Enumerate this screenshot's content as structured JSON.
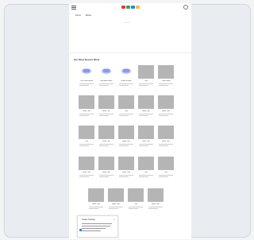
{
  "header": {
    "logo_colors": [
      "#e53935",
      "#43a047",
      "#1e88e5",
      "#fbc02d"
    ],
    "links": [
      "Home",
      "Books"
    ],
    "hero_text": "Search"
  },
  "section": {
    "heading": "Our Most Recent Work"
  },
  "rows": [
    {
      "items": [
        {
          "title": "Our Planet Book",
          "illus": true
        },
        {
          "title": "Big Ideas Book",
          "illus": true
        },
        {
          "title": "Science Book",
          "illus": true
        },
        {
          "title": "Title",
          "illus": false
        },
        {
          "title": "Cover Book",
          "illus": false
        }
      ]
    },
    {
      "items": [
        {
          "title": "Book Title",
          "illus": false
        },
        {
          "title": "Book Title",
          "illus": false
        },
        {
          "title": "Title",
          "illus": false
        },
        {
          "title": "Book Title",
          "illus": false
        },
        {
          "title": "Book Title",
          "illus": false
        }
      ]
    },
    {
      "items": [
        {
          "title": "Title",
          "illus": false
        },
        {
          "title": "Book Title",
          "illus": false
        },
        {
          "title": "Book Title",
          "illus": false
        },
        {
          "title": "Book Title",
          "illus": false
        },
        {
          "title": "Book Title",
          "illus": false
        }
      ]
    },
    {
      "items": [
        {
          "title": "Book Title",
          "illus": false
        },
        {
          "title": "Book Title",
          "illus": false
        },
        {
          "title": "Book Title",
          "illus": false
        },
        {
          "title": "Title",
          "illus": false
        },
        {
          "title": "Title",
          "illus": false
        }
      ]
    },
    {
      "items": [
        {
          "title": "Book Title",
          "illus": false
        },
        {
          "title": "Book Title",
          "illus": false
        },
        {
          "title": "Title",
          "illus": false
        },
        {
          "title": "Book Title",
          "illus": false
        }
      ]
    }
  ],
  "cookie": {
    "title": "Cookie Settings",
    "close": "×"
  }
}
